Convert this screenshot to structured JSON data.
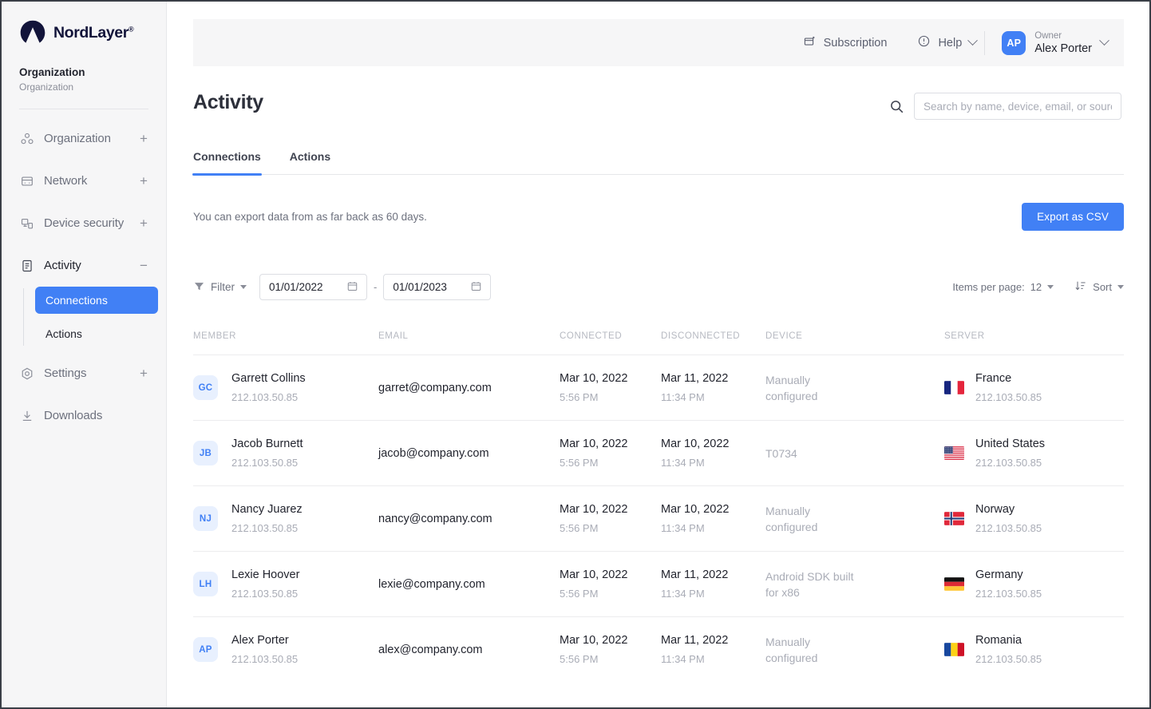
{
  "sidebar": {
    "logo_text": "NordLayer",
    "logo_reg": "®",
    "org_title": "Organization",
    "org_subtitle": "Organization",
    "items": [
      {
        "label": "Organization",
        "icon": "organization-icon",
        "expander": "+"
      },
      {
        "label": "Network",
        "icon": "network-icon",
        "expander": "+"
      },
      {
        "label": "Device security",
        "icon": "device-security-icon",
        "expander": "+"
      },
      {
        "label": "Activity",
        "icon": "activity-icon",
        "expander": "−"
      },
      {
        "label": "Settings",
        "icon": "settings-icon",
        "expander": "+"
      },
      {
        "label": "Downloads",
        "icon": "download-icon",
        "expander": ""
      }
    ],
    "sub_items": [
      {
        "label": "Connections",
        "selected": true
      },
      {
        "label": "Actions",
        "selected": false
      }
    ]
  },
  "topbar": {
    "subscription_label": "Subscription",
    "help_label": "Help",
    "user_initials": "AP",
    "user_role": "Owner",
    "user_name": "Alex Porter"
  },
  "header": {
    "page_title": "Activity",
    "search_placeholder": "Search by name, device, email, or source",
    "search_value": ""
  },
  "tabs": [
    {
      "label": "Connections",
      "active": true
    },
    {
      "label": "Actions",
      "active": false
    }
  ],
  "export": {
    "note": "You can export data from as far back as 60 days.",
    "button_label": "Export as CSV"
  },
  "filters": {
    "filter_label": "Filter",
    "date_from": "01/01/2022",
    "date_to": "01/01/2023",
    "date_separator": "-",
    "items_per_page_label": "Items per page:",
    "items_per_page_value": "12",
    "sort_label": "Sort"
  },
  "table": {
    "columns": [
      "MEMBER",
      "EMAIL",
      "CONNECTED",
      "DISCONNECTED",
      "DEVICE",
      "SERVER"
    ],
    "rows": [
      {
        "initials": "GC",
        "name": "Garrett Collins",
        "ip": "212.103.50.85",
        "email": "garret@company.com",
        "connected_date": "Mar 10, 2022",
        "connected_time": "5:56 PM",
        "disconnected_date": "Mar 11, 2022",
        "disconnected_time": "11:34 PM",
        "device": "Manually configured",
        "server_country": "France",
        "server_ip": "212.103.50.85",
        "flag": "fr"
      },
      {
        "initials": "JB",
        "name": "Jacob Burnett",
        "ip": "212.103.50.85",
        "email": "jacob@company.com",
        "connected_date": "Mar 10, 2022",
        "connected_time": "5:56 PM",
        "disconnected_date": "Mar 10, 2022",
        "disconnected_time": "11:34 PM",
        "device": "T0734",
        "server_country": "United States",
        "server_ip": "212.103.50.85",
        "flag": "us"
      },
      {
        "initials": "NJ",
        "name": "Nancy Juarez",
        "ip": "212.103.50.85",
        "email": "nancy@company.com",
        "connected_date": "Mar 10, 2022",
        "connected_time": "5:56 PM",
        "disconnected_date": "Mar 10, 2022",
        "disconnected_time": "11:34 PM",
        "device": "Manually configured",
        "server_country": "Norway",
        "server_ip": "212.103.50.85",
        "flag": "no"
      },
      {
        "initials": "LH",
        "name": "Lexie Hoover",
        "ip": "212.103.50.85",
        "email": "lexie@company.com",
        "connected_date": "Mar 10, 2022",
        "connected_time": "5:56 PM",
        "disconnected_date": "Mar 11, 2022",
        "disconnected_time": "11:34 PM",
        "device": "Android SDK built for x86",
        "server_country": "Germany",
        "server_ip": "212.103.50.85",
        "flag": "de"
      },
      {
        "initials": "AP",
        "name": "Alex Porter",
        "ip": "212.103.50.85",
        "email": "alex@company.com",
        "connected_date": "Mar 10, 2022",
        "connected_time": "5:56 PM",
        "disconnected_date": "Mar 11, 2022",
        "disconnected_time": "11:34 PM",
        "device": "Manually configured",
        "server_country": "Romania",
        "server_ip": "212.103.50.85",
        "flag": "ro"
      }
    ]
  },
  "colors": {
    "accent": "#4180f5",
    "sidebar_bg": "#f6f6f7",
    "logo_navy": "#12143a",
    "avatar_bg": "#e8f0fe",
    "text_primary": "#22242e",
    "text_muted": "#a9acb6"
  }
}
